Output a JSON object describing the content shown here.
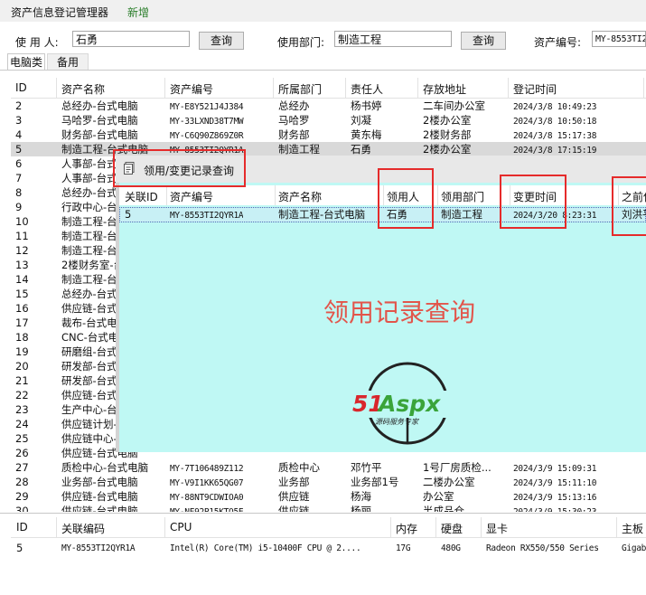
{
  "menu": {
    "items": [
      "资产信息登记管理器",
      "新增"
    ]
  },
  "filters": {
    "user_label": "使 用 人:",
    "user_value": "石勇",
    "query_btn_1": "查询",
    "dept_label": "使用部门:",
    "dept_value": "制造工程",
    "query_btn_2": "查询",
    "code_label": "资产编号:",
    "code_value": "MY-8553TI2"
  },
  "tabs": [
    "电脑类",
    "备用"
  ],
  "grid": {
    "columns": [
      "ID",
      "资产名称",
      "资产编号",
      "所属部门",
      "责任人",
      "存放地址",
      "登记时间"
    ],
    "rows": [
      [
        "2",
        "总经办-台式电脑",
        "MY-E8Y521J4J384",
        "总经办",
        "杨书婷",
        "二车间办公室",
        "2024/3/8 10:49:23"
      ],
      [
        "3",
        "马哈罗-台式电脑",
        "MY-33LXND38T7MW",
        "马哈罗",
        "刘凝",
        "2楼办公室",
        "2024/3/8 10:50:18"
      ],
      [
        "4",
        "财务部-台式电脑",
        "MY-C6Q90Z869Z0R",
        "财务部",
        "黄东梅",
        "2楼财务部",
        "2024/3/8 15:17:38"
      ],
      [
        "5",
        "制造工程-台式电脑",
        "MY-8553TI2QYR1A",
        "制造工程",
        "石勇",
        "2楼办公室",
        "2024/3/8 17:15:19"
      ],
      [
        "6",
        "人事部-台式电脑",
        "",
        "",
        "",
        "",
        ""
      ],
      [
        "7",
        "人事部-台式电脑",
        "",
        "",
        "",
        "",
        ""
      ],
      [
        "8",
        "总经办-台式电脑",
        "",
        "",
        "",
        "",
        ""
      ],
      [
        "9",
        "行政中心-台式电脑",
        "",
        "",
        "",
        "",
        ""
      ],
      [
        "10",
        "制造工程-台式电脑",
        "",
        "",
        "",
        "",
        ""
      ],
      [
        "11",
        "制造工程-台式电脑",
        "",
        "",
        "",
        "",
        ""
      ],
      [
        "12",
        "制造工程-台式电脑",
        "",
        "",
        "",
        "",
        ""
      ],
      [
        "13",
        "2楼财务室-台式电脑",
        "",
        "",
        "",
        "",
        ""
      ],
      [
        "14",
        "制造工程-台式电脑",
        "",
        "",
        "",
        "",
        ""
      ],
      [
        "15",
        "总经办-台式电脑",
        "",
        "",
        "",
        "",
        ""
      ],
      [
        "16",
        "供应链-台式电脑",
        "",
        "",
        "",
        "",
        ""
      ],
      [
        "17",
        "裁布-台式电脑",
        "",
        "",
        "",
        "",
        ""
      ],
      [
        "18",
        "CNC-台式电脑",
        "",
        "",
        "",
        "",
        ""
      ],
      [
        "19",
        "研磨组-台式电脑",
        "",
        "",
        "",
        "",
        ""
      ],
      [
        "20",
        "研发部-台式电脑",
        "",
        "",
        "",
        "",
        ""
      ],
      [
        "21",
        "研发部-台式电脑",
        "",
        "",
        "",
        "",
        ""
      ],
      [
        "22",
        "供应链-台式电脑",
        "",
        "",
        "",
        "",
        ""
      ],
      [
        "23",
        "生产中心-台式电脑",
        "",
        "",
        "",
        "",
        ""
      ],
      [
        "24",
        "供应链计划-台式电脑",
        "",
        "",
        "",
        "",
        ""
      ],
      [
        "25",
        "供应链中心-台式电脑",
        "",
        "",
        "",
        "",
        ""
      ],
      [
        "26",
        "供应链-台式电脑",
        "",
        "",
        "",
        "",
        ""
      ],
      [
        "27",
        "质检中心-台式电脑",
        "MY-7T106489Z112",
        "质检中心",
        "邓竹平",
        "1号厂房质检...",
        "2024/3/9 15:09:31"
      ],
      [
        "28",
        "业务部-台式电脑",
        "MY-V9I1KK65QG07",
        "业务部",
        "业务部1号",
        "二楼办公室",
        "2024/3/9 15:11:10"
      ],
      [
        "29",
        "供应链-台式电脑",
        "MY-88NT9CDWIOA0",
        "供应链",
        "杨海",
        "办公室",
        "2024/3/9 15:13:16"
      ],
      [
        "30",
        "供应链-台式电脑",
        "MY-NF92P15KTO5E",
        "供应链",
        "杨丽",
        "半成品仓",
        "2024/3/9 15:30:23"
      ]
    ],
    "selected_id": "5"
  },
  "detail": {
    "columns": [
      "ID",
      "关联编码",
      "CPU",
      "内存",
      "硬盘",
      "显卡",
      "主板"
    ],
    "rows": [
      [
        "5",
        "MY-8553TI2QYR1A",
        "Intel(R) Core(TM) i5-10400F CPU @ 2....",
        "17G",
        "480G",
        "Radeon RX550/550 Series",
        "Gigab"
      ]
    ]
  },
  "dialog": {
    "title": "领用/变更记录查询",
    "columns": [
      "关联ID",
      "资产编号",
      "资产名称",
      "领用人",
      "领用部门",
      "变更时间",
      "之前使用人"
    ],
    "row": [
      "5",
      "MY-8553TI2QYR1A",
      "制造工程-台式电脑",
      "石勇",
      "制造工程",
      "2024/3/20 8:23:31",
      "刘洪平"
    ],
    "watermark": "领用记录查询",
    "logo_main": "51Aspx",
    "logo_sub": "源码服务专家"
  },
  "colors": {
    "accent_red": "#e2554b",
    "highlight_box": "#e52b2b",
    "dialog_bg": "#bff8f4",
    "logo_green": "#3aa43a"
  }
}
